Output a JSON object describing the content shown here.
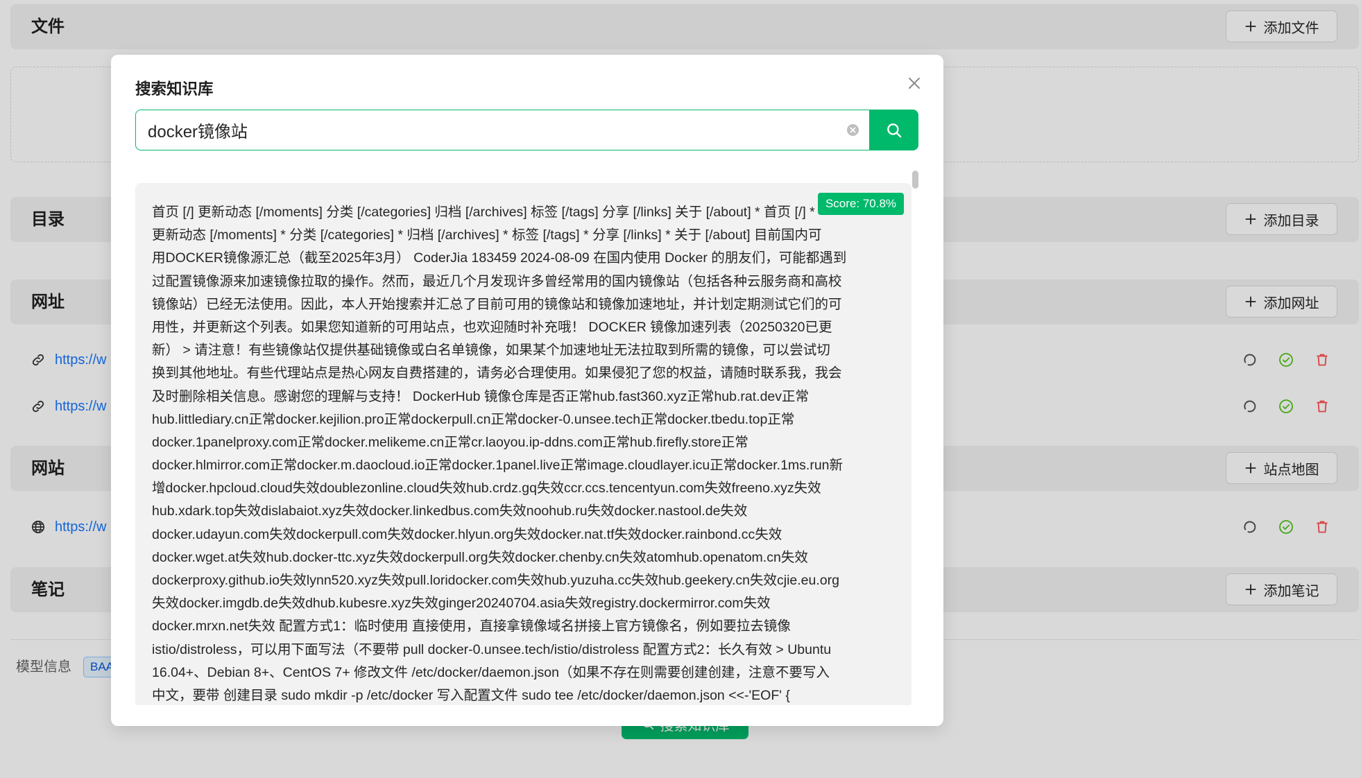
{
  "page": {
    "sections": {
      "files": {
        "title": "文件",
        "button": "添加文件"
      },
      "dirs": {
        "title": "目录",
        "button": "添加目录"
      },
      "urls": {
        "title": "网址",
        "button": "添加网址",
        "items": [
          {
            "url": "https://w"
          },
          {
            "url": "https://w"
          }
        ]
      },
      "sites": {
        "title": "网站",
        "button": "站点地图",
        "items": [
          {
            "url": "https://w"
          }
        ]
      },
      "notes": {
        "title": "笔记",
        "button": "添加笔记"
      }
    },
    "model_info": {
      "label": "模型信息",
      "tag": "BAA"
    },
    "search_button": "搜索知识库"
  },
  "modal": {
    "title": "搜索知识库",
    "query": "docker镜像站",
    "result": {
      "score": "Score: 70.8%",
      "lines": [
        "首页 [/] 更新动态 [/moments] 分类 [/categories] 归档 [/archives] 标签 [/tags] 分享 [/links] 关于 [/about] * 首页 [/] *",
        "更新动态 [/moments] * 分类 [/categories] * 归档 [/archives] * 标签 [/tags] * 分享 [/links] * 关于 [/about] 目前国内可",
        "用DOCKER镜像源汇总（截至2025年3月） CoderJia 183459 2024-08-09 在国内使用 Docker 的朋友们，可能都遇到",
        "过配置镜像源来加速镜像拉取的操作。然而，最近几个月发现许多曾经常用的国内镜像站（包括各种云服务商和高校",
        "镜像站）已经无法使用。因此，本人开始搜索并汇总了目前可用的镜像站和镜像加速地址，并计划定期测试它们的可",
        "用性，并更新这个列表。如果您知道新的可用站点，也欢迎随时补充哦！ DOCKER 镜像加速列表（20250320已更",
        "新） > 请注意！有些镜像站仅提供基础镜像或白名单镜像，如果某个加速地址无法拉取到所需的镜像，可以尝试切",
        "换到其他地址。有些代理站点是热心网友自费搭建的，请务必合理使用。如果侵犯了您的权益，请随时联系我，我会",
        "及时删除相关信息。感谢您的理解与支持！ DockerHub 镜像仓库是否正常hub.fast360.xyz正常hub.rat.dev正常",
        "hub.littlediary.cn正常docker.kejilion.pro正常dockerpull.cn正常docker-0.unsee.tech正常docker.tbedu.top正常",
        "docker.1panelproxy.com正常docker.melikeme.cn正常cr.laoyou.ip-ddns.com正常hub.firefly.store正常",
        "docker.hlmirror.com正常docker.m.daocloud.io正常docker.1panel.live正常image.cloudlayer.icu正常docker.1ms.run新",
        "增docker.hpcloud.cloud失效doublezonline.cloud失效hub.crdz.gq失效ccr.ccs.tencentyun.com失效freeno.xyz失效",
        "hub.xdark.top失效dislabaiot.xyz失效docker.linkedbus.com失效noohub.ru失效docker.nastool.de失效",
        "docker.udayun.com失效dockerpull.com失效docker.hlyun.org失效docker.nat.tf失效docker.rainbond.cc失效",
        "docker.wget.at失效hub.docker-ttc.xyz失效dockerpull.org失效docker.chenby.cn失效atomhub.openatom.cn失效",
        "dockerproxy.github.io失效lynn520.xyz失效pull.loridocker.com失效hub.yuzuha.cc失效hub.geekery.cn失效cjie.eu.org",
        "失效docker.imgdb.de失效dhub.kubesre.xyz失效ginger20240704.asia失效registry.dockermirror.com失效",
        "docker.mrxn.net失效 配置方式1：临时使用 直接使用，直接拿镜像域名拼接上官方镜像名，例如要拉去镜像",
        "istio/distroless，可以用下面写法（不要带 pull docker-0.unsee.tech/istio/distroless 配置方式2：长久有效 > Ubuntu",
        "16.04+、Debian 8+、CentOS 7+ 修改文件 /etc/docker/daemon.json（如果不存在则需要创建创建，注意不要写入",
        "中文，要带 创建目录 sudo mkdir -p /etc/docker 写入配置文件 sudo tee /etc/docker/daemon.json <<-'EOF' {"
      ]
    }
  },
  "colors": {
    "accent": "#00b96b",
    "link": "#1677ff",
    "success": "#52c41a",
    "danger": "#ff4d4f",
    "tag_text": "#0958d9"
  },
  "icons": {
    "add": "plus-icon",
    "url": "link-icon",
    "site": "globe-icon",
    "refresh": "refresh-icon",
    "status": "check-circle-icon",
    "delete": "trash-icon",
    "close": "close-icon",
    "clear": "clear-icon",
    "search": "search-icon"
  }
}
